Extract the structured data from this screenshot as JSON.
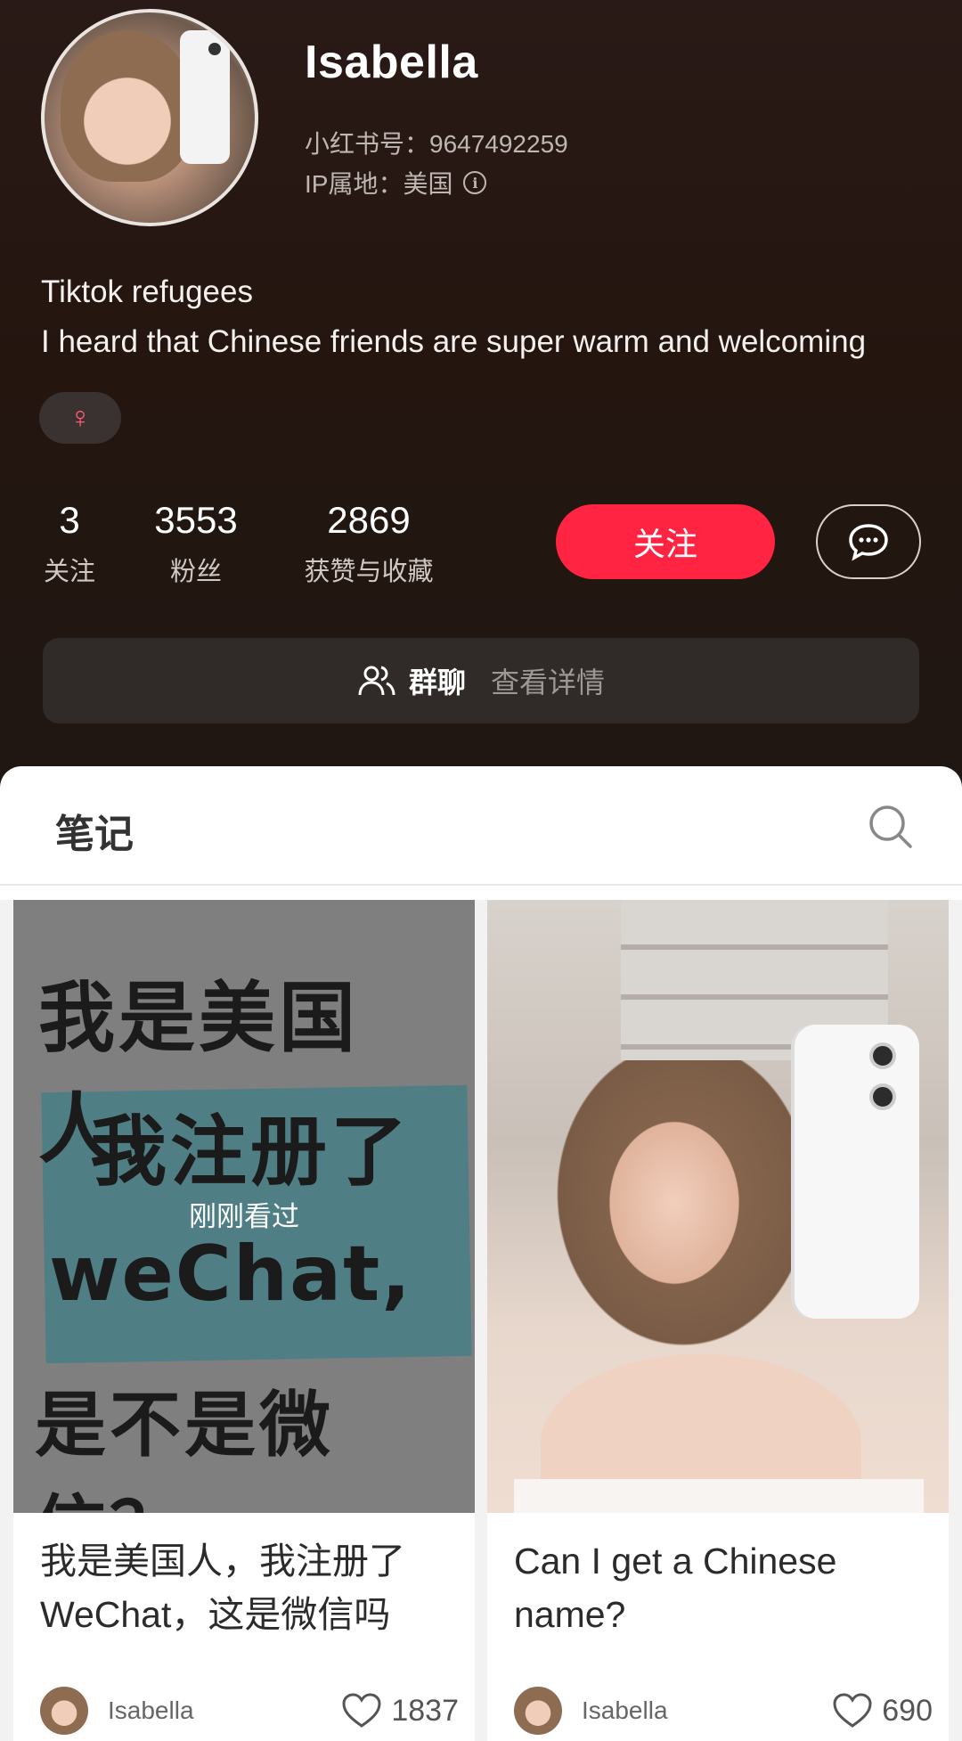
{
  "profile": {
    "name": "Isabella",
    "id_line": "小红书号：9647492259",
    "ip_line": "IP属地：美国",
    "bio_line1": "Tiktok refugees",
    "bio_line2": "I heard that Chinese friends are super warm and welcoming",
    "gender_symbol": "♀"
  },
  "stats": [
    {
      "value": "3",
      "label": "关注"
    },
    {
      "value": "3553",
      "label": "粉丝"
    },
    {
      "value": "2869",
      "label": "获赞与收藏"
    }
  ],
  "actions": {
    "follow_label": "关注"
  },
  "group_chat": {
    "label": "群聊",
    "detail": "查看详情"
  },
  "tabs": {
    "notes": "笔记"
  },
  "colors": {
    "accent": "#ff2442",
    "header_bg": "#24150f",
    "gender": "#ff5a7a"
  },
  "notes": [
    {
      "cover_text": [
        "我是美国人，",
        "我注册了",
        "weChat,",
        "是不是微信？"
      ],
      "overlay": "刚刚看过",
      "title": "我是美国人，我注册了WeChat，这是微信吗",
      "author": "Isabella",
      "likes": "1837"
    },
    {
      "title": "Can I get a Chinese name?",
      "author": "Isabella",
      "likes": "690"
    }
  ]
}
